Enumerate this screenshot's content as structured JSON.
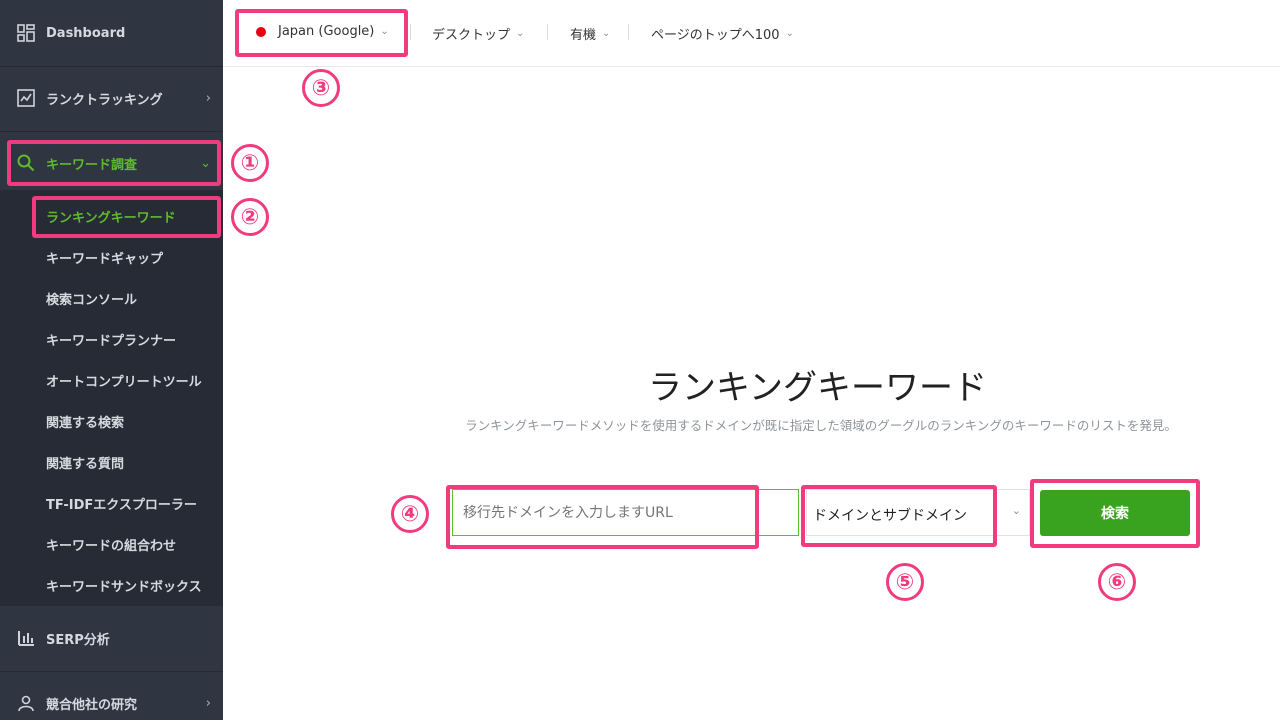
{
  "sidebar": {
    "dashboard": "Dashboard",
    "rank_tracking": "ランクトラッキング",
    "keyword_research": "キーワード調査",
    "sub_items": [
      "ランキングキーワード",
      "キーワードギャップ",
      "検索コンソール",
      "キーワードプランナー",
      "オートコンプリートツール",
      "関連する検索",
      "関連する質問",
      "TF-IDFエクスプローラー",
      "キーワードの組合わせ",
      "キーワードサンドボックス"
    ],
    "serp_analysis": "SERP分析",
    "competitor_research": "競合他社の研究"
  },
  "topbar": {
    "location": "Japan (Google)",
    "device": "デスクトップ",
    "result_type": "有機",
    "depth": "ページのトップへ100"
  },
  "main": {
    "title": "ランキングキーワード",
    "description": "ランキングキーワードメソッドを使用するドメインが既に指定した領域のグーグルのランキングのキーワードのリストを発見。",
    "url_placeholder": "移行先ドメインを入力しますURL",
    "scope_value": "ドメインとサブドメイン",
    "search_button": "検索"
  },
  "annotations": [
    "①",
    "②",
    "③",
    "④",
    "⑤",
    "⑥"
  ],
  "colors": {
    "sidebar_bg": "#2f3541",
    "accent_green": "#5dbb2e",
    "button_green": "#39a320",
    "annotation_pink": "#f03b7e",
    "flag_red": "#e60012"
  }
}
